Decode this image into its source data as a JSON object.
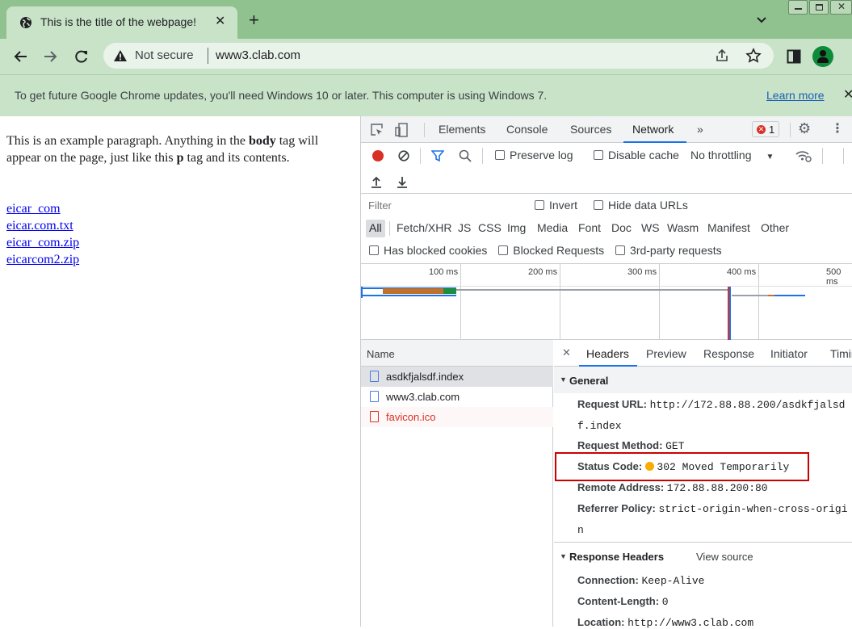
{
  "tab": {
    "title": "This is the title of the webpage!",
    "close": "✕",
    "new_tab": "+"
  },
  "toolbar": {
    "security": "Not secure",
    "url": "www3.clab.com"
  },
  "infobar": {
    "message": "To get future Google Chrome updates, you'll need Windows 10 or later. This computer is using Windows 7.",
    "learn_more": "Learn more"
  },
  "page": {
    "p_before": "This is an example paragraph. Anything in the ",
    "p_body": "body",
    "p_mid": " tag will appear on the page, just like this ",
    "p_p": "p",
    "p_after": " tag and its contents.",
    "links": [
      "eicar_com",
      "eicar.com.txt",
      "eicar_com.zip",
      "eicarcom2.zip"
    ]
  },
  "devtools": {
    "tabs": [
      "Elements",
      "Console",
      "Sources",
      "Network",
      "»"
    ],
    "error_count": "1",
    "preserve_log": "Preserve log",
    "disable_cache": "Disable cache",
    "throttling": "No throttling",
    "filter_placeholder": "Filter",
    "invert": "Invert",
    "hide_data_urls": "Hide data URLs",
    "types": [
      "All",
      "Fetch/XHR",
      "JS",
      "CSS",
      "Img",
      "Media",
      "Font",
      "Doc",
      "WS",
      "Wasm",
      "Manifest",
      "Other"
    ],
    "has_blocked_cookies": "Has blocked cookies",
    "blocked_requests": "Blocked Requests",
    "third_party": "3rd-party requests",
    "ticks": [
      "100 ms",
      "200 ms",
      "300 ms",
      "400 ms",
      "500 ms"
    ],
    "name_header": "Name",
    "requests": [
      "asdkfjalsdf.index",
      "www3.clab.com",
      "favicon.ico"
    ],
    "detail_tabs": [
      "Headers",
      "Preview",
      "Response",
      "Initiator",
      "Timing"
    ],
    "general": "General",
    "request_url_k": "Request URL:",
    "request_url_v1": "http://172.88.88.200/asdkfjalsd",
    "request_url_v2": "f.index",
    "method_k": "Request Method:",
    "method_v": "GET",
    "status_k": "Status Code:",
    "status_v": "302 Moved Temporarily",
    "remote_k": "Remote Address:",
    "remote_v": "172.88.88.200:80",
    "referrer_k": "Referrer Policy:",
    "referrer_v1": "strict-origin-when-cross-origi",
    "referrer_v2": "n",
    "response_headers": "Response Headers",
    "view_source": "View source",
    "connection_k": "Connection:",
    "connection_v": "Keep-Alive",
    "content_length_k": "Content-Length:",
    "content_length_v": "0",
    "location_k": "Location:",
    "location_v": "http://www3.clab.com"
  },
  "colors": {
    "chrome_frame": "#90c28f",
    "toolbar": "#c9e3c8",
    "highlight": "#cc0000",
    "error": "#d93025",
    "accent": "#1a73e8"
  }
}
